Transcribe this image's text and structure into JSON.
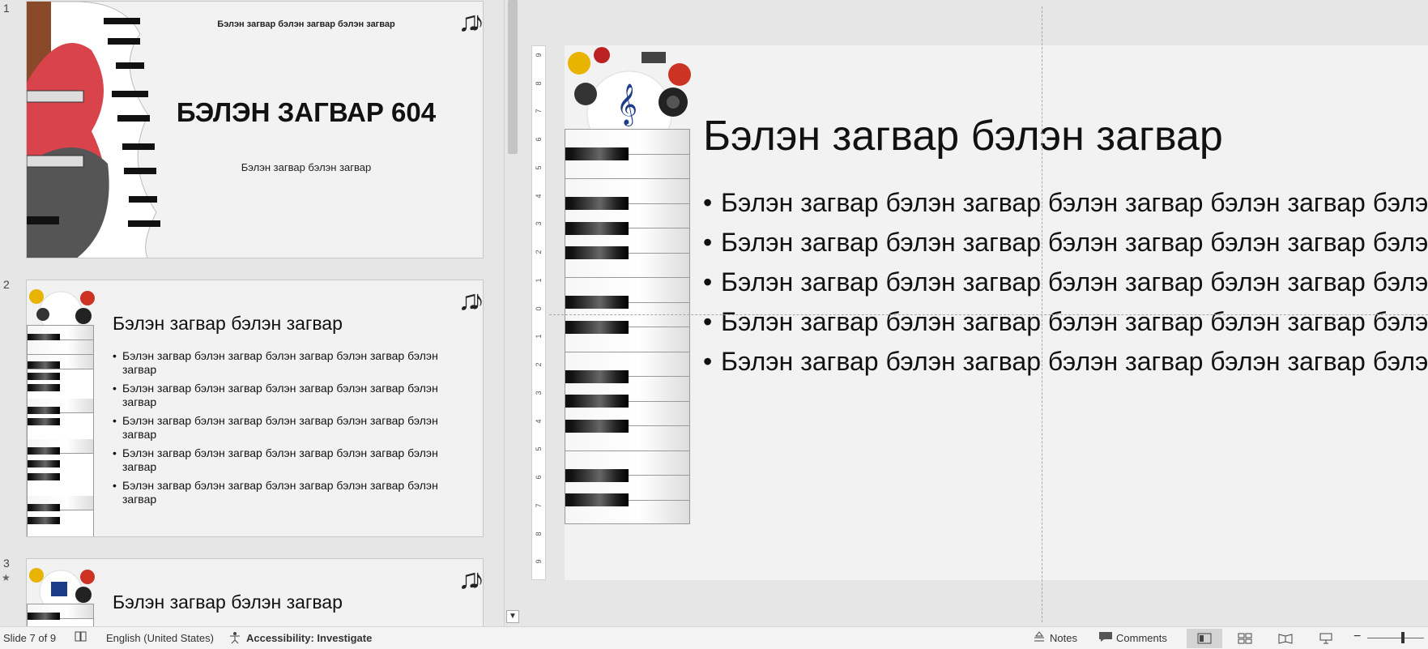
{
  "thumbnails": [
    {
      "number": "1",
      "top_text": "Бэлэн загвар бэлэн загвар бэлэн загвар",
      "title": "БЭЛЭН ЗАГВАР 604",
      "subtitle": "Бэлэн загвар бэлэн загвар"
    },
    {
      "number": "2",
      "title": "Бэлэн загвар бэлэн загвар",
      "bullets": [
        "Бэлэн загвар бэлэн загвар бэлэн загвар бэлэн загвар бэлэн загвар",
        "Бэлэн загвар бэлэн загвар бэлэн загвар бэлэн загвар бэлэн загвар",
        "Бэлэн загвар бэлэн загвар бэлэн загвар бэлэн загвар бэлэн загвар",
        "Бэлэн загвар бэлэн загвар бэлэн загвар бэлэн загвар бэлэн загвар",
        "Бэлэн загвар бэлэн загвар бэлэн загвар бэлэн загвар бэлэн загвар"
      ]
    },
    {
      "number": "3",
      "star": "★",
      "title": "Бэлэн загвар бэлэн загвар"
    }
  ],
  "music_notes": "♫♪",
  "treble_clef": "𝄞",
  "main_slide": {
    "title": "Бэлэн загвар бэлэн загвар",
    "bullets": [
      "Бэлэн загвар бэлэн загвар бэлэн загвар бэлэн загвар бэлэн загвар",
      "Бэлэн загвар бэлэн загвар бэлэн загвар бэлэн загвар бэлэн загвар",
      "Бэлэн загвар бэлэн загвар бэлэн загвар бэлэн загвар бэлэн загвар",
      "Бэлэн загвар бэлэн загвар бэлэн загвар бэлэн загвар бэлэн загвар",
      "Бэлэн загвар бэлэн загвар бэлэн загвар бэлэн загвар бэлэн загвар"
    ]
  },
  "ruler_labels": [
    "9",
    "8",
    "7",
    "6",
    "5",
    "4",
    "3",
    "2",
    "1",
    "0",
    "1",
    "2",
    "3",
    "4",
    "5",
    "6",
    "7",
    "8",
    "9"
  ],
  "status_bar": {
    "slide_info": "Slide 7 of 9",
    "language": "English (United States)",
    "accessibility": "Accessibility: Investigate",
    "notes": "Notes",
    "comments": "Comments"
  },
  "icons": {
    "spellcheck": "spellcheck-icon",
    "accessibility": "accessibility-icon",
    "notes": "notes-icon",
    "comments": "comments-icon",
    "normal_view": "normal-view-icon",
    "sorter_view": "slide-sorter-icon",
    "reading_view": "reading-view-icon",
    "slideshow": "slideshow-icon"
  },
  "colors": {
    "guitar_red": "#d9434b",
    "selection": "#d4d4d4"
  }
}
